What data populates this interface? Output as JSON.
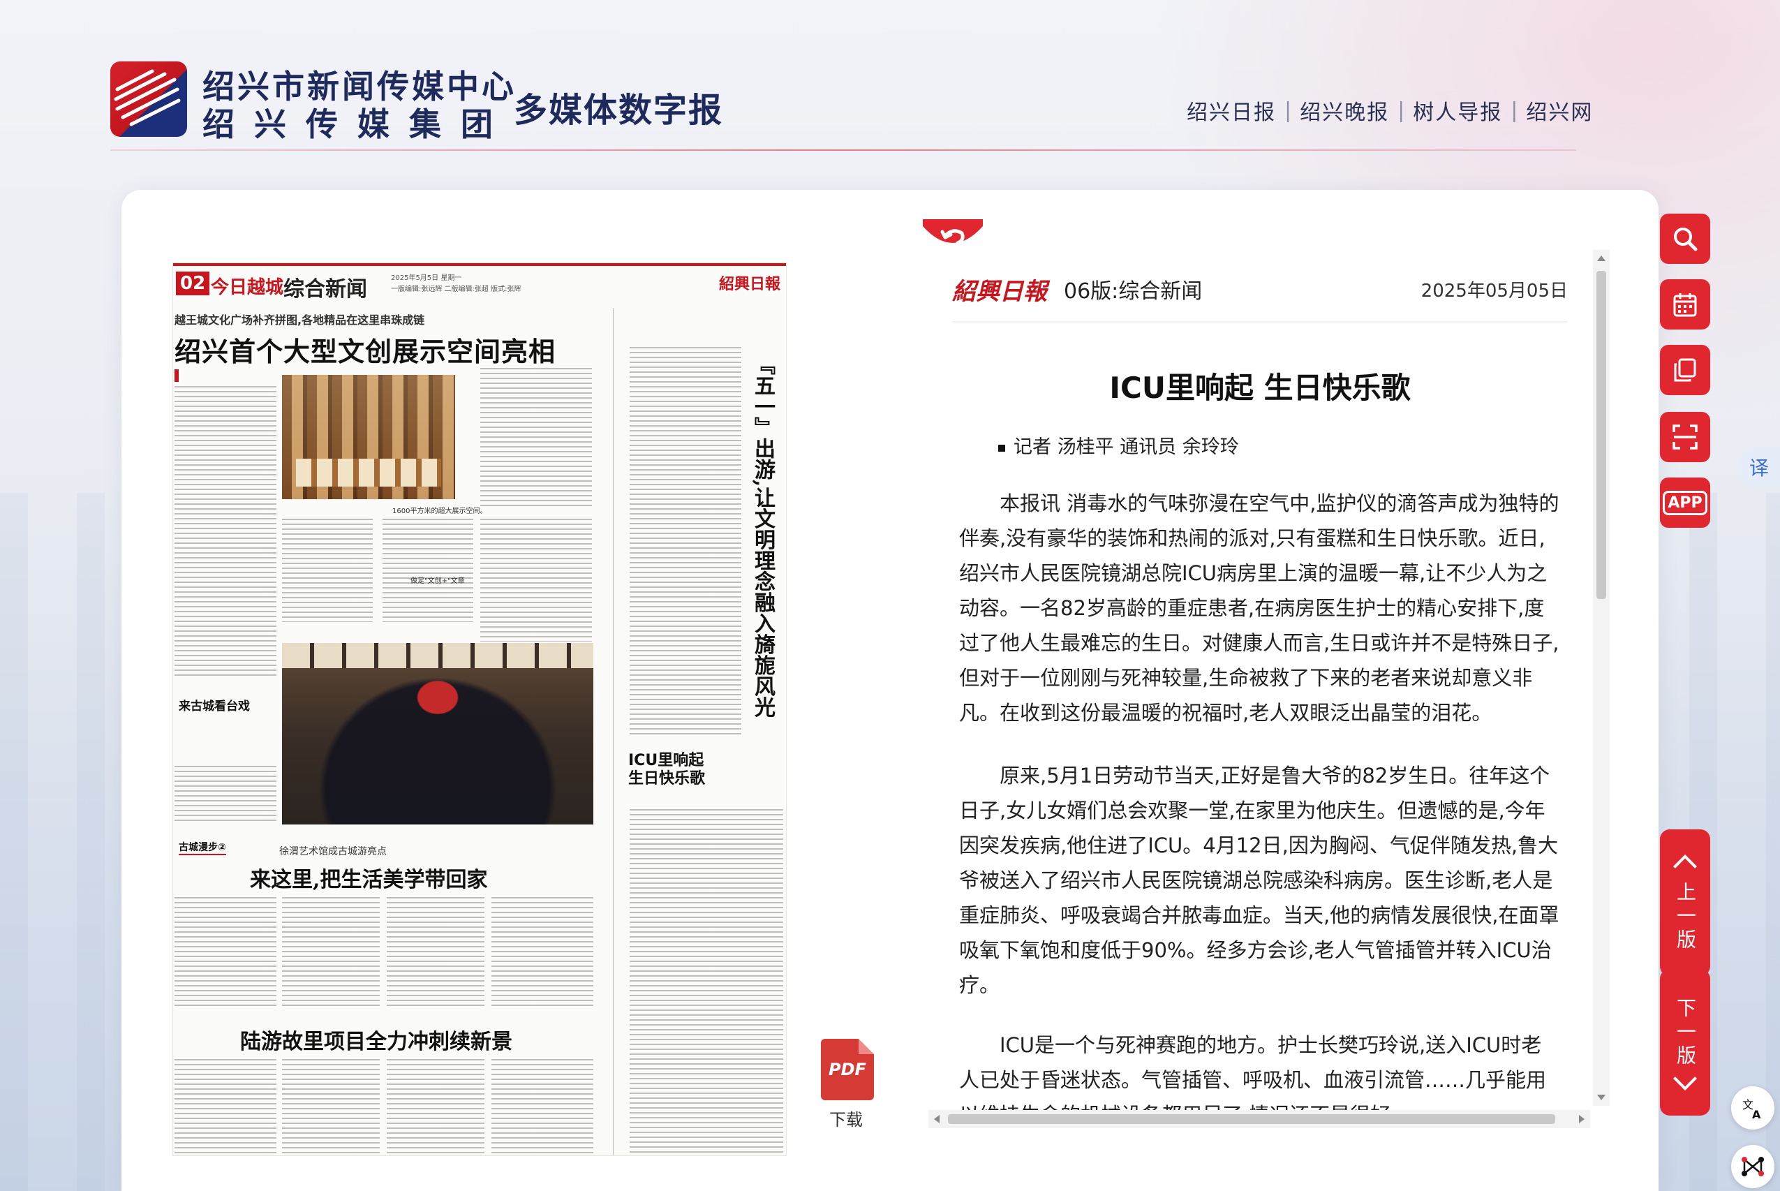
{
  "header": {
    "org_name_1": "绍兴市新闻传媒中心",
    "org_name_2": "绍兴传媒集团",
    "product": "多媒体数字报",
    "nav": [
      "绍兴日报",
      "绍兴晚报",
      "树人导报",
      "绍兴网"
    ]
  },
  "newspaper": {
    "page_no": "02",
    "brand": "今日越城",
    "section": "综合新闻",
    "meta": [
      "2025年5月5日 星期一",
      "一版编辑:张远辉 二版编辑:张超 版式:张辉"
    ],
    "logo": "紹興日報",
    "sub1": "越王城文化广场补齐拼图,各地精品在这里串珠成链",
    "headline1": "绍兴首个大型文创展示空间亮相",
    "caption1": "1600平方米的超大展示空间。",
    "caption2": "做足\"文创+\"文章",
    "side_title": "来古城看台戏",
    "tag": "古城漫步②",
    "sub2": "徐渭艺术馆成古城游亮点",
    "headline2": "来这里,把生活美学带回家",
    "headline3": "陆游故里项目全力冲刺续新景",
    "vertical_headline": "『五一』出游,让文明理念融入旖旎风光",
    "icu_headline": "ICU里响起\n生日快乐歌"
  },
  "pdf": {
    "label": "下载",
    "icon_text": "PDF"
  },
  "reader": {
    "logo": "紹興日報",
    "page": "06版:综合新闻",
    "date": "2025年05月05日",
    "title": "ICU里响起 生日快乐歌",
    "byline": "记者 汤桂平 通讯员 余玲玲",
    "paragraphs": [
      "本报讯 消毒水的气味弥漫在空气中,监护仪的滴答声成为独特的伴奏,没有豪华的装饰和热闹的派对,只有蛋糕和生日快乐歌。近日,绍兴市人民医院镜湖总院ICU病房里上演的温暖一幕,让不少人为之动容。一名82岁高龄的重症患者,在病房医生护士的精心安排下,度过了他人生最难忘的生日。对健康人而言,生日或许并不是特殊日子,但对于一位刚刚与死神较量,生命被救了下来的老者来说却意义非凡。在收到这份最温暖的祝福时,老人双眼泛出晶莹的泪花。",
      "原来,5月1日劳动节当天,正好是鲁大爷的82岁生日。往年这个日子,女儿女婿们总会欢聚一堂,在家里为他庆生。但遗憾的是,今年因突发疾病,他住进了ICU。4月12日,因为胸闷、气促伴随发热,鲁大爷被送入了绍兴市人民医院镜湖总院感染科病房。医生诊断,老人是重症肺炎、呼吸衰竭合并脓毒血症。当天,他的病情发展很快,在面罩吸氧下氧饱和度低于90%。经多方会诊,老人气管插管并转入ICU治疗。",
      "ICU是一个与死神赛跑的地方。护士长樊巧玲说,送入ICU时老人已处于昏迷状态。气管插管、呼吸机、血液引流管……几乎能用以维持生命的机械设备都用尽了,情况还不是很好。"
    ]
  },
  "tools": [
    "search",
    "calendar",
    "copy",
    "scan",
    "APP"
  ],
  "translate_label": "译",
  "prev_page": "上一版",
  "next_page": "下一版",
  "colors": {
    "accent": "#e0262e",
    "brand_navy": "#1e2a5c"
  }
}
